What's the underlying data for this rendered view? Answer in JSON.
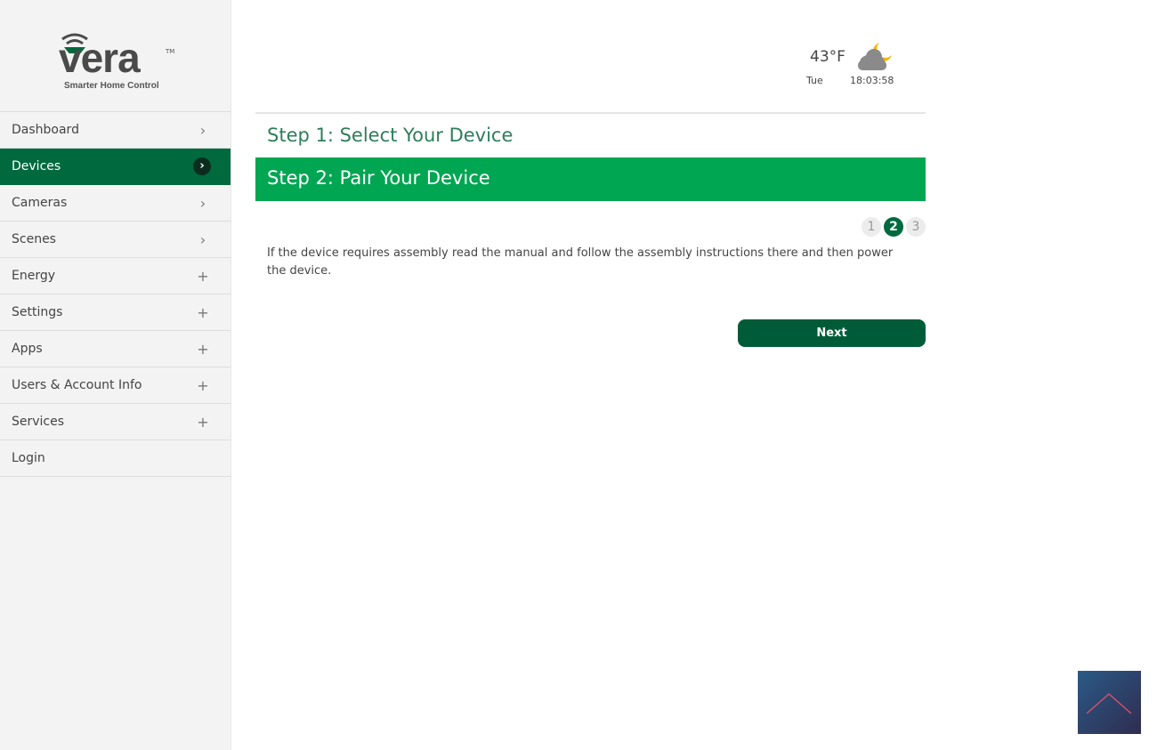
{
  "brand": {
    "name": "vera",
    "tagline": "Smarter Home Control",
    "tm": "TM"
  },
  "sidebar": {
    "items": [
      {
        "label": "Dashboard",
        "icon": "chevron-right"
      },
      {
        "label": "Devices",
        "icon": "chevron-right",
        "active": true
      },
      {
        "label": "Cameras",
        "icon": "chevron-right"
      },
      {
        "label": "Scenes",
        "icon": "chevron-right"
      },
      {
        "label": "Energy",
        "icon": "plus"
      },
      {
        "label": "Settings",
        "icon": "plus"
      },
      {
        "label": "Apps",
        "icon": "plus"
      },
      {
        "label": "Users & Account Info",
        "icon": "plus"
      },
      {
        "label": "Services",
        "icon": "plus"
      },
      {
        "label": "Login",
        "icon": ""
      }
    ]
  },
  "weather": {
    "temp": "43°F",
    "day": "Tue",
    "time": "18:03:58",
    "icon": "cloud-moon-icon"
  },
  "wizard": {
    "step1": "Step 1: Select Your Device",
    "step2": "Step 2: Pair Your Device",
    "pages": [
      "1",
      "2",
      "3"
    ],
    "current_page": 2,
    "instructions": "If the device requires assembly read the manual and follow the assembly instructions there and then power the device.",
    "next_label": "Next"
  },
  "colors": {
    "accent": "#00693e",
    "step_active": "#00a651"
  }
}
